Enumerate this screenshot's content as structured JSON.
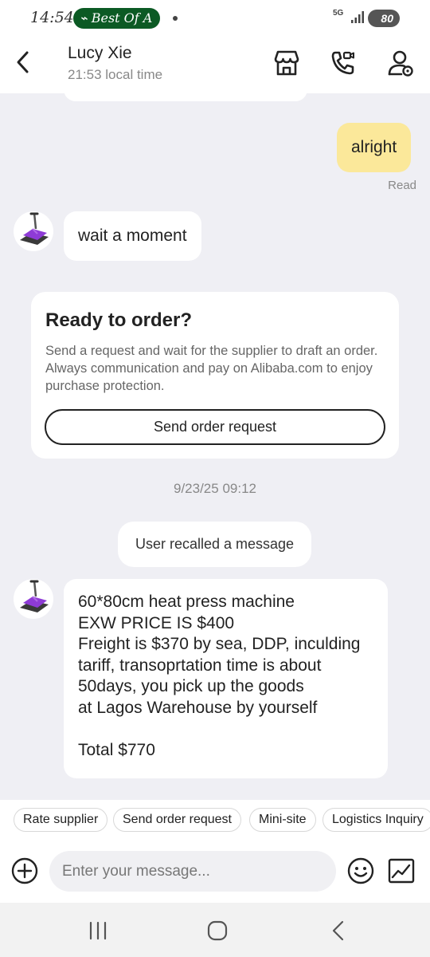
{
  "status_bar": {
    "time": "14:54",
    "notification_pill": "Best Of A",
    "network": "5G",
    "battery": "80"
  },
  "header": {
    "contact_name": "Lucy Xie",
    "local_time": "21:53 local time"
  },
  "messages": {
    "outgoing_text": "alright",
    "read_status": "Read",
    "incoming_short": "wait a moment",
    "order_card": {
      "title": "Ready to order?",
      "description": "Send a request and wait for the supplier to draft an order. Always communication and pay on Alibaba.com to enjoy purchase protection.",
      "button_label": "Send order request"
    },
    "timestamp": "9/23/25 09:12",
    "system_notice": "User recalled a message",
    "incoming_long_lines": [
      "60*80cm heat press machine",
      "EXW PRICE IS $400",
      "Freight is $370 by sea, DDP, inculding",
      "tariff, transoprtation time is about",
      "50days, you pick up the goods",
      "at Lagos Warehouse by yourself",
      "",
      "Total $770"
    ]
  },
  "quick_actions": [
    "Rate supplier",
    "Send order request",
    "Mini-site",
    "Logistics Inquiry"
  ],
  "composer": {
    "placeholder": "Enter your message..."
  },
  "colors": {
    "outgoing_bubble": "#fbe89a",
    "background": "#efeff4",
    "status_pill": "#0c5a24"
  },
  "icons": {
    "header": [
      "back-icon",
      "store-icon",
      "video-call-icon",
      "contact-profile-icon"
    ],
    "composer": [
      "plus-circle-icon",
      "emoji-icon",
      "image-icon"
    ],
    "nav": [
      "recent-apps-icon",
      "home-icon",
      "back-nav-icon"
    ]
  }
}
